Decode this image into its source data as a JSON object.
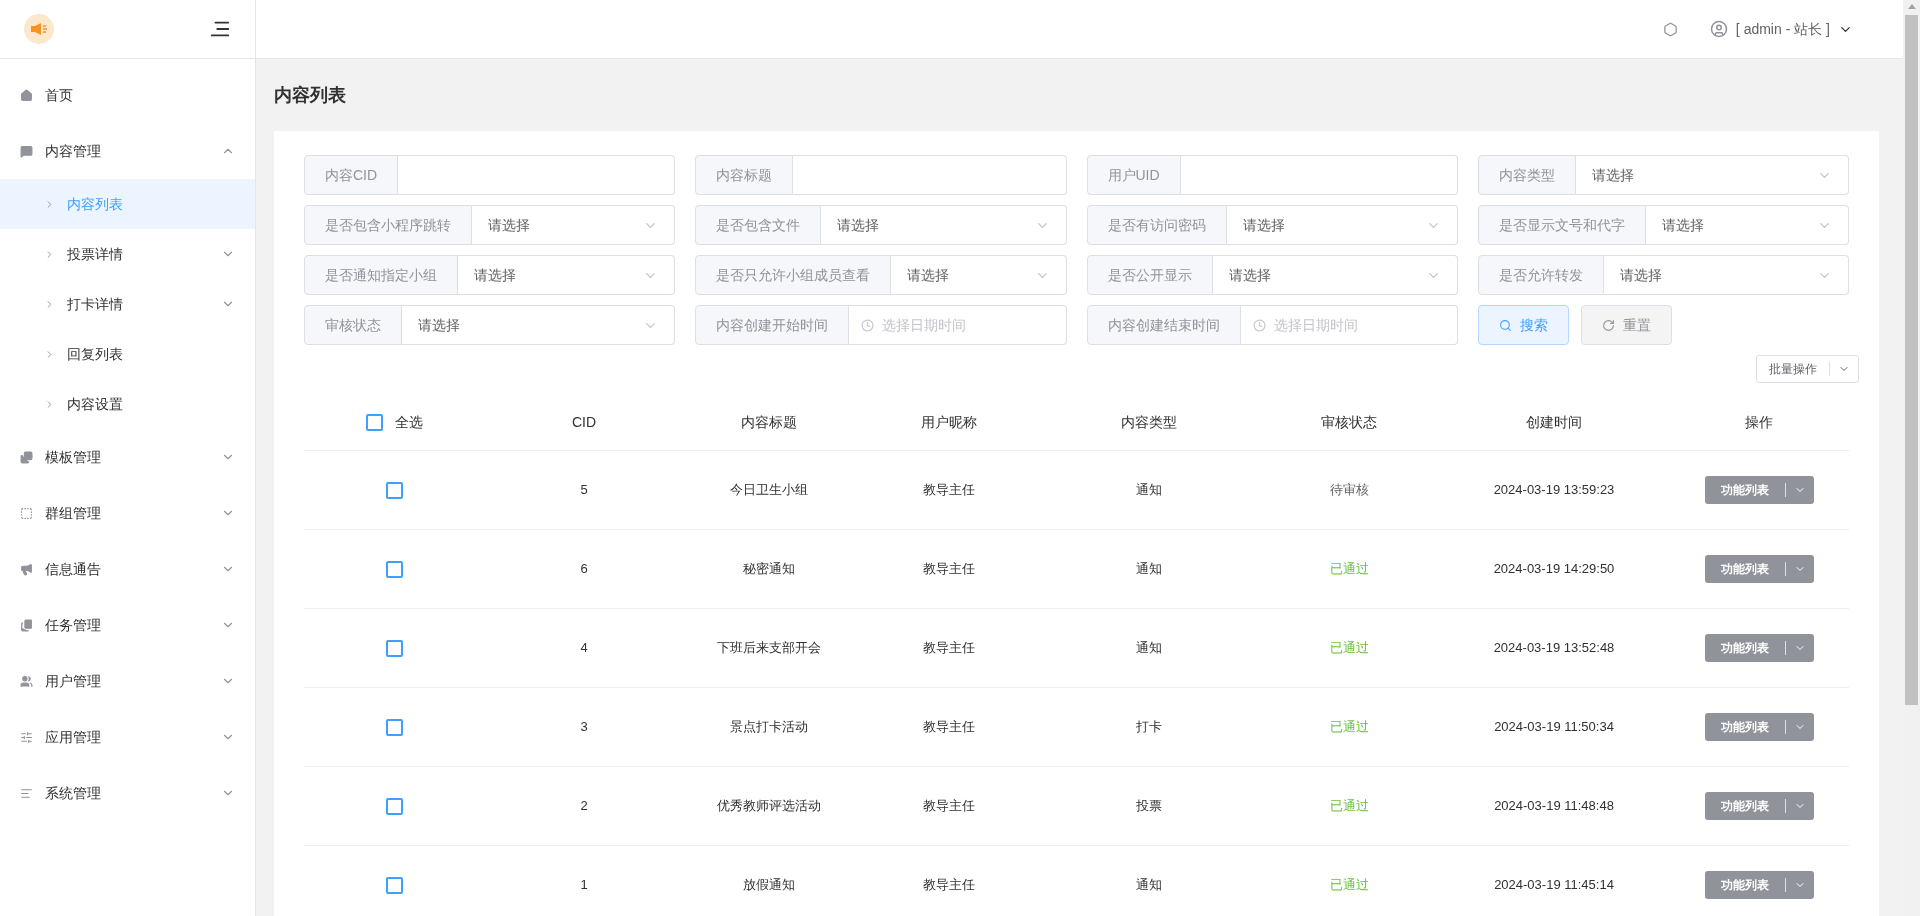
{
  "header": {
    "user": "[ admin - 站长 ]"
  },
  "sidebar": {
    "items": [
      {
        "label": "首页",
        "has_children": false
      },
      {
        "label": "内容管理",
        "expanded": true,
        "has_children": true,
        "children": [
          {
            "label": "内容列表",
            "selected": true,
            "has_children": false
          },
          {
            "label": "投票详情",
            "selected": false,
            "has_children": true
          },
          {
            "label": "打卡详情",
            "selected": false,
            "has_children": true
          },
          {
            "label": "回复列表",
            "selected": false,
            "has_children": false
          },
          {
            "label": "内容设置",
            "selected": false,
            "has_children": false
          }
        ]
      },
      {
        "label": "模板管理",
        "expanded": false,
        "has_children": true
      },
      {
        "label": "群组管理",
        "expanded": false,
        "has_children": true
      },
      {
        "label": "信息通告",
        "expanded": false,
        "has_children": true
      },
      {
        "label": "任务管理",
        "expanded": false,
        "has_children": true
      },
      {
        "label": "用户管理",
        "expanded": false,
        "has_children": true
      },
      {
        "label": "应用管理",
        "expanded": false,
        "has_children": true
      },
      {
        "label": "系统管理",
        "expanded": false,
        "has_children": true
      }
    ]
  },
  "page_title": "内容列表",
  "filters": [
    {
      "label": "内容CID",
      "kind": "text"
    },
    {
      "label": "内容标题",
      "kind": "text"
    },
    {
      "label": "用户UID",
      "kind": "text"
    },
    {
      "label": "内容类型",
      "kind": "select",
      "placeholder": "请选择"
    },
    {
      "label": "是否包含小程序跳转",
      "kind": "select",
      "placeholder": "请选择"
    },
    {
      "label": "是否包含文件",
      "kind": "select",
      "placeholder": "请选择"
    },
    {
      "label": "是否有访问密码",
      "kind": "select",
      "placeholder": "请选择"
    },
    {
      "label": "是否显示文号和代字",
      "kind": "select",
      "placeholder": "请选择"
    },
    {
      "label": "是否通知指定小组",
      "kind": "select",
      "placeholder": "请选择"
    },
    {
      "label": "是否只允许小组成员查看",
      "kind": "select",
      "placeholder": "请选择"
    },
    {
      "label": "是否公开显示",
      "kind": "select",
      "placeholder": "请选择"
    },
    {
      "label": "是否允许转发",
      "kind": "select",
      "placeholder": "请选择"
    },
    {
      "label": "审核状态",
      "kind": "select",
      "placeholder": "请选择"
    },
    {
      "label": "内容创建开始时间",
      "kind": "date",
      "placeholder": "选择日期时间"
    },
    {
      "label": "内容创建结束时间",
      "kind": "date",
      "placeholder": "选择日期时间"
    }
  ],
  "search_button": "搜索",
  "reset_button": "重置",
  "batch_button": "批量操作",
  "table": {
    "select_all": {
      "label": "全选",
      "checked": false
    },
    "columns": [
      "CID",
      "内容标题",
      "用户昵称",
      "内容类型",
      "审核状态",
      "创建时间",
      "操作"
    ],
    "rows": [
      {
        "checked": false,
        "cid": "5",
        "title": "今日卫生小组",
        "nickname": "教导主任",
        "type": "通知",
        "status": "待审核",
        "color": "#606266",
        "time": "2024-03-19 13:59:23",
        "action": "功能列表"
      },
      {
        "checked": false,
        "cid": "6",
        "title": "秘密通知",
        "nickname": "教导主任",
        "type": "通知",
        "status": "已通过",
        "color": "#67c23a",
        "time": "2024-03-19 14:29:50",
        "action": "功能列表"
      },
      {
        "checked": false,
        "cid": "4",
        "title": "下班后来支部开会",
        "nickname": "教导主任",
        "type": "通知",
        "status": "已通过",
        "color": "#67c23a",
        "time": "2024-03-19 13:52:48",
        "action": "功能列表"
      },
      {
        "checked": false,
        "cid": "3",
        "title": "景点打卡活动",
        "nickname": "教导主任",
        "type": "打卡",
        "status": "已通过",
        "color": "#67c23a",
        "time": "2024-03-19 11:50:34",
        "action": "功能列表"
      },
      {
        "checked": false,
        "cid": "2",
        "title": "优秀教师评选活动",
        "nickname": "教导主任",
        "type": "投票",
        "status": "已通过",
        "color": "#67c23a",
        "time": "2024-03-19 11:48:48",
        "action": "功能列表"
      },
      {
        "checked": false,
        "cid": "1",
        "title": "放假通知",
        "nickname": "教导主任",
        "type": "通知",
        "status": "已通过",
        "color": "#67c23a",
        "time": "2024-03-19 11:45:14",
        "action": "功能列表"
      }
    ]
  }
}
